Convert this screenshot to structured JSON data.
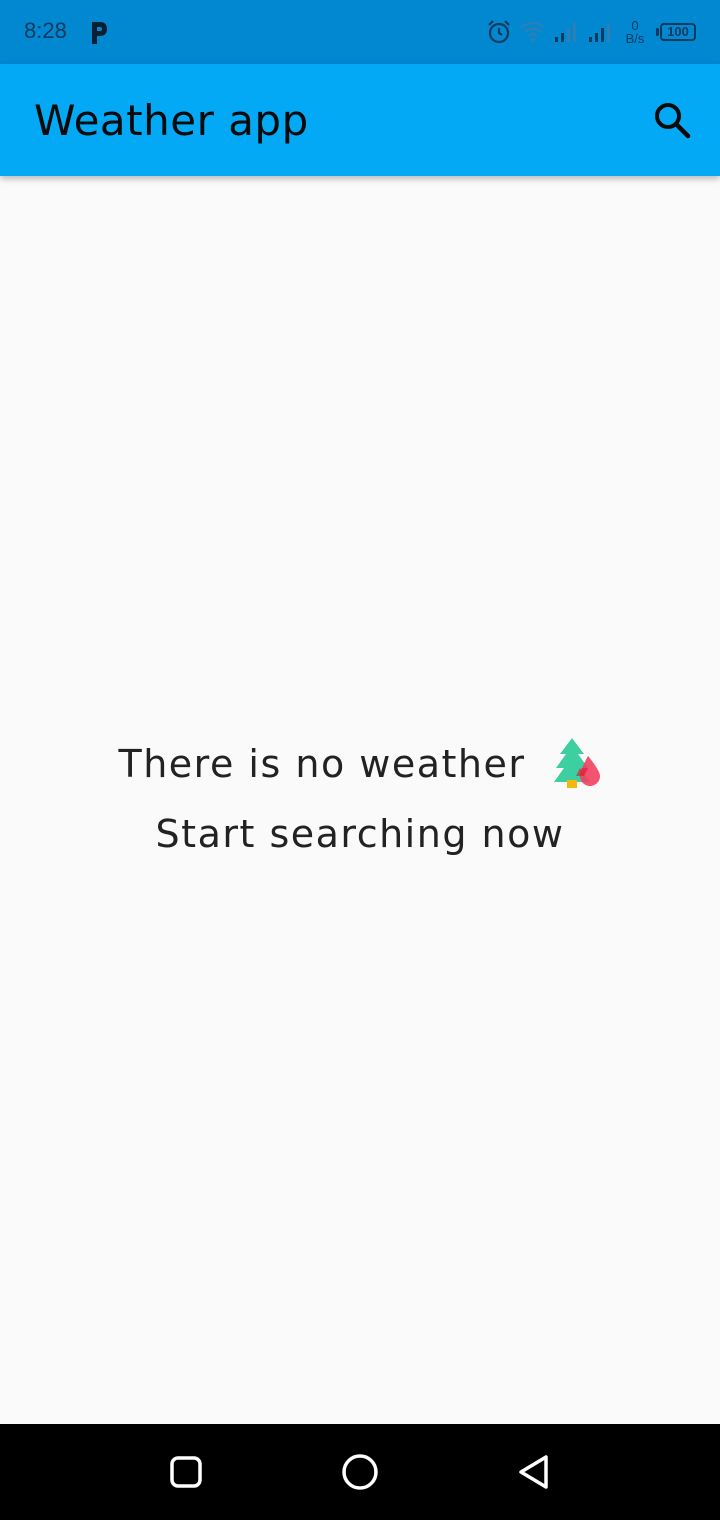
{
  "status_bar": {
    "time": "8:28",
    "net_speed_value": "0",
    "net_speed_unit": "B/s",
    "battery": "100",
    "icons": [
      "p-app-icon",
      "alarm-icon",
      "wifi-icon",
      "signal-icon",
      "signal-icon"
    ]
  },
  "app_bar": {
    "title": "Weather app",
    "action_icon": "search-icon",
    "background": "#03a9f4"
  },
  "main": {
    "message_line1": "There is no weather",
    "message_line2": "Start searching now",
    "emoji_icon": "tree-drop-icon"
  },
  "nav_bar": {
    "buttons": [
      "recents-square-icon",
      "home-circle-icon",
      "back-triangle-icon"
    ]
  }
}
